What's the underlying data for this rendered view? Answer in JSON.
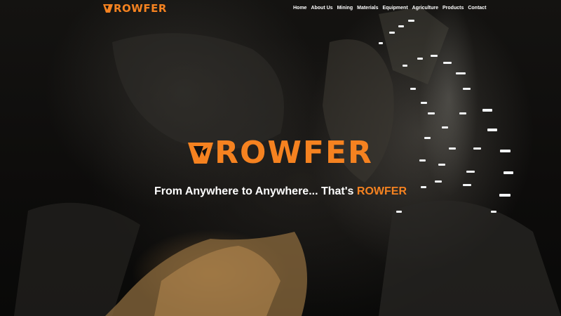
{
  "header": {
    "logo_text": "ROWFER",
    "nav_items": [
      "Home",
      "About Us",
      "Mining",
      "Materials",
      "Equipment",
      "Agriculture",
      "Products",
      "Contact"
    ]
  },
  "hero": {
    "logo_text": "ROWFER",
    "tagline_prefix": "From Anywhere to Anywhere... That's ",
    "tagline_brand": "ROWFER",
    "background_image": "mine-tunnel-photo"
  },
  "colors": {
    "accent": "#f58220",
    "text": "#ffffff",
    "background": "#0b0b0a"
  },
  "icons": [
    "logo-mark-icon"
  ]
}
